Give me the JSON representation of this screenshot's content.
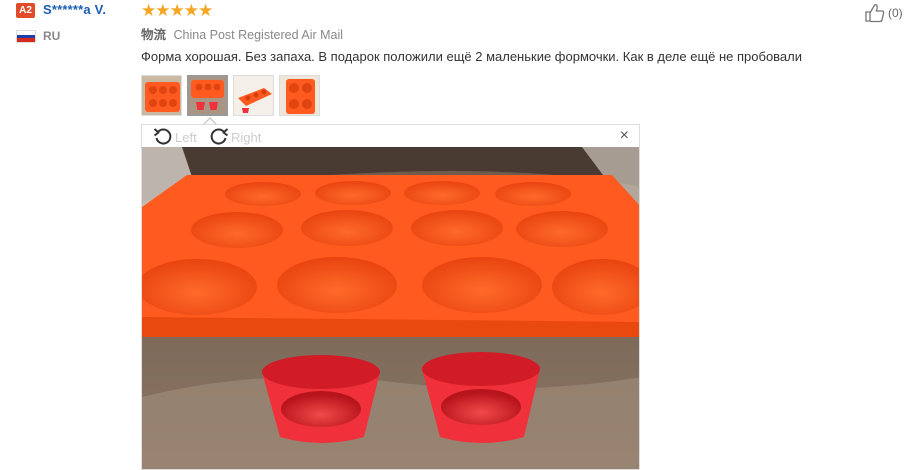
{
  "reviewer": {
    "badge": "A2",
    "name": "S******a V.",
    "country": "RU"
  },
  "rating": {
    "stars": "★★★★★"
  },
  "shipping": {
    "label": "物流",
    "method": "China Post Registered Air Mail"
  },
  "helpful": {
    "count": "(0)"
  },
  "review": {
    "text": "Форма хорошая. Без запаха. В подарок положили ещё 2 маленькие формочки. Как в деле ещё не пробовали"
  },
  "thumbnails": [
    {
      "name": "muffin-tray-photo"
    },
    {
      "name": "cups-and-tray-photo"
    },
    {
      "name": "tray-side-photo"
    },
    {
      "name": "tray-closeup-photo"
    }
  ],
  "viewer": {
    "rotate_left": "Left",
    "rotate_right": "Right",
    "close": "×"
  },
  "icons": {
    "thumb_up": "thumbs-up-icon",
    "rotate_left": "rotate-left-icon",
    "rotate_right": "rotate-right-icon",
    "close": "close-icon"
  },
  "colors": {
    "badge": "#e04b2a",
    "username": "#1a5fb4",
    "stars": "#f6a623",
    "tray": "#ff5a1f",
    "cups": "#f0303a"
  }
}
